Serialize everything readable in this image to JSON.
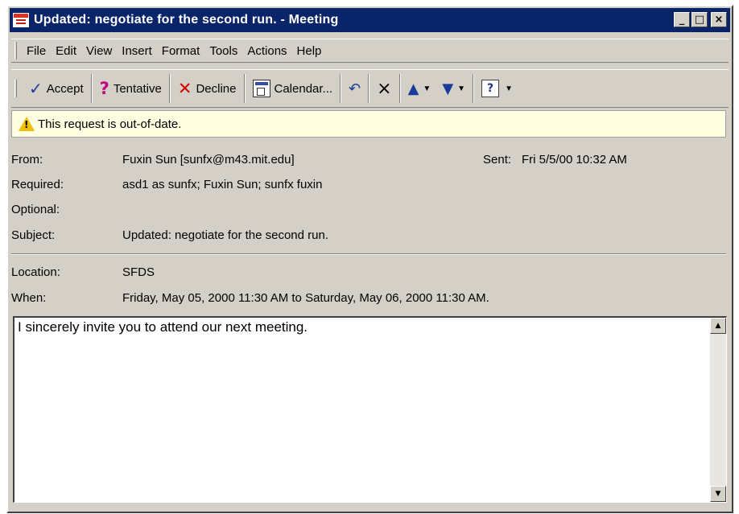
{
  "window": {
    "title": "Updated: negotiate for the second run. - Meeting",
    "minimize_glyph": "_",
    "maximize_glyph": "□",
    "close_glyph": "×"
  },
  "menu": {
    "items": [
      "File",
      "Edit",
      "View",
      "Insert",
      "Format",
      "Tools",
      "Actions",
      "Help"
    ]
  },
  "toolbar": {
    "accept_label": "Accept",
    "tentative_label": "Tentative",
    "decline_label": "Decline",
    "calendar_label": "Calendar...",
    "icons": [
      "check-icon",
      "question-icon",
      "decline-x-icon",
      "calendar-icon",
      "reply-icon",
      "delete-icon",
      "previous-arrow-icon",
      "next-arrow-icon",
      "help-icon"
    ]
  },
  "infobar": {
    "message": "This request is out-of-date."
  },
  "header": {
    "from_label": "From:",
    "from_value": "Fuxin Sun [sunfx@m43.mit.edu]",
    "sent_label": "Sent:",
    "sent_value": "Fri 5/5/00 10:32 AM",
    "required_label": "Required:",
    "required_value": "asd1 as sunfx; Fuxin Sun; sunfx fuxin",
    "optional_label": "Optional:",
    "optional_value": "",
    "subject_label": "Subject:",
    "subject_value": "Updated: negotiate for the second run.",
    "location_label": "Location:",
    "location_value": "SFDS",
    "when_label": "When:",
    "when_value": "Friday, May 05, 2000 11:30 AM to Saturday, May 06, 2000 11:30 AM."
  },
  "body": {
    "text": "I sincerely invite you to attend our next meeting."
  },
  "colors": {
    "titlebar": "#0a246a",
    "chrome": "#d4d0c8",
    "infobar": "#ffffe1"
  }
}
